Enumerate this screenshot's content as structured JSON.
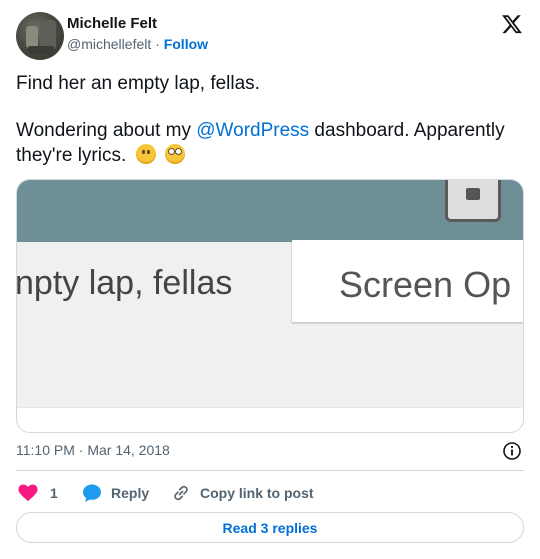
{
  "author": {
    "name": "Michelle Felt",
    "handle": "@michellefelt",
    "separator": "·",
    "follow_label": "Follow"
  },
  "tweet": {
    "line1": "Find her an empty lap, fellas.",
    "line2_before": "Wondering about my ",
    "mention": "@WordPress",
    "line2_after": " dashboard. Apparently they're lyrics."
  },
  "media": {
    "left_text": "npty lap, fellas",
    "button_text": "Screen Op",
    "colors": {
      "top_bar": "#6f8f96",
      "panel": "#f0f0f1"
    }
  },
  "meta": {
    "timestamp": "11:10 PM · Mar 14, 2018"
  },
  "actions": {
    "like_count": "1",
    "reply_label": "Reply",
    "copy_label": "Copy link to post"
  },
  "replies_button": "Read 3 replies",
  "icons": [
    "x-logo-icon",
    "heart-icon",
    "reply-bubble-icon",
    "link-icon",
    "info-icon",
    "upside-down-face-emoji",
    "eye-roll-emoji"
  ],
  "colors": {
    "accent": "#006fd6",
    "like": "#f91880",
    "reply": "#1d9bf0",
    "muted": "#536471"
  }
}
